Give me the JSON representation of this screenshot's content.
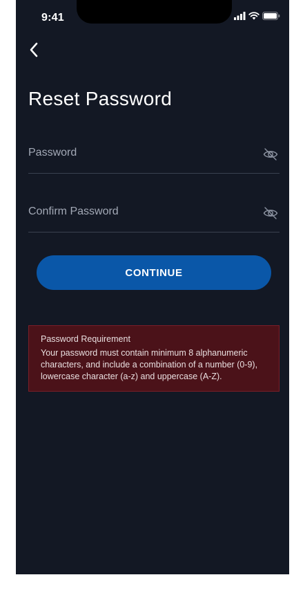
{
  "status_bar": {
    "time": "9:41"
  },
  "header": {
    "title": "Reset Password"
  },
  "form": {
    "password_label": "Password",
    "confirm_label": "Confirm Password",
    "continue_label": "CONTINUE"
  },
  "requirement": {
    "title": "Password Requirement",
    "text": "Your password must contain minimum 8 alphanumeric characters, and include a combination of a number (0-9), lowercase character (a-z) and uppercase (A-Z)."
  },
  "icons": {
    "back": "chevron-left-icon",
    "visibility": "eye-off-icon",
    "signal": "cellular-signal-icon",
    "wifi": "wifi-icon",
    "battery": "battery-icon"
  },
  "colors": {
    "background": "#131824",
    "primary_button": "#0a57a8",
    "error_panel": "#4b1219",
    "error_border": "#7a1e28",
    "field_label": "#a3a9b6"
  }
}
